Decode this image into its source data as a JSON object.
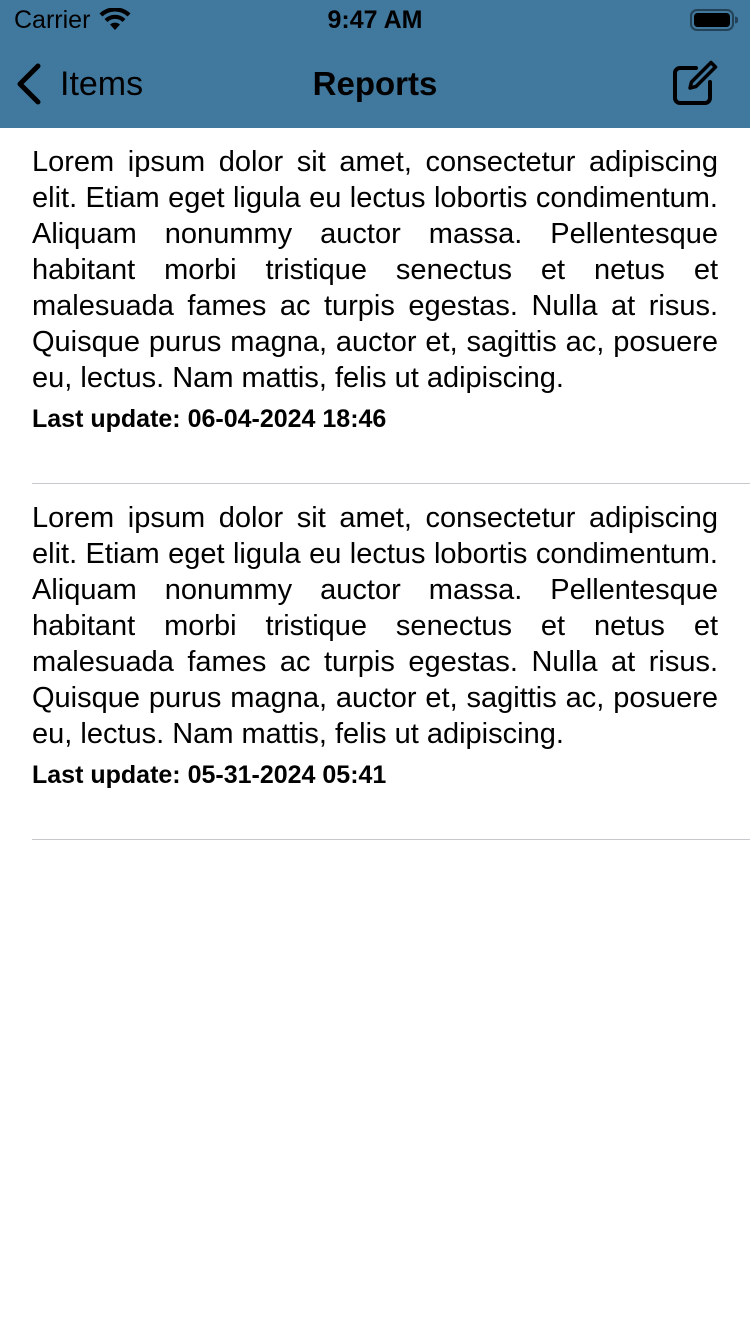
{
  "status_bar": {
    "carrier": "Carrier",
    "time": "9:47 AM",
    "wifi_icon": "wifi-icon",
    "battery_icon": "battery-icon"
  },
  "nav": {
    "back_label": "Items",
    "title": "Reports",
    "back_icon": "chevron-left-icon",
    "compose_icon": "compose-icon",
    "bar_color": "#41789e"
  },
  "reports": [
    {
      "text": "Lorem ipsum dolor sit amet, consectetur adipiscing elit. Etiam eget ligula eu lectus lobortis condimentum. Aliquam nonummy auctor massa. Pellentesque habitant morbi tristique senectus et netus et malesuada fames ac turpis egestas. Nulla at risus. Quisque purus magna, auctor et, sagittis ac, posuere eu, lectus. Nam mattis, felis ut adipiscing.",
      "date": "Last update: 06-04-2024 18:46"
    },
    {
      "text": "Lorem ipsum dolor sit amet, consectetur adipiscing elit. Etiam eget ligula eu lectus lobortis condimentum. Aliquam nonummy auctor massa. Pellentesque habitant morbi tristique senectus et netus et malesuada fames ac turpis egestas. Nulla at risus. Quisque purus magna, auctor et, sagittis ac, posuere eu, lectus. Nam mattis, felis ut adipiscing.",
      "date": "Last update: 05-31-2024 05:41"
    }
  ]
}
